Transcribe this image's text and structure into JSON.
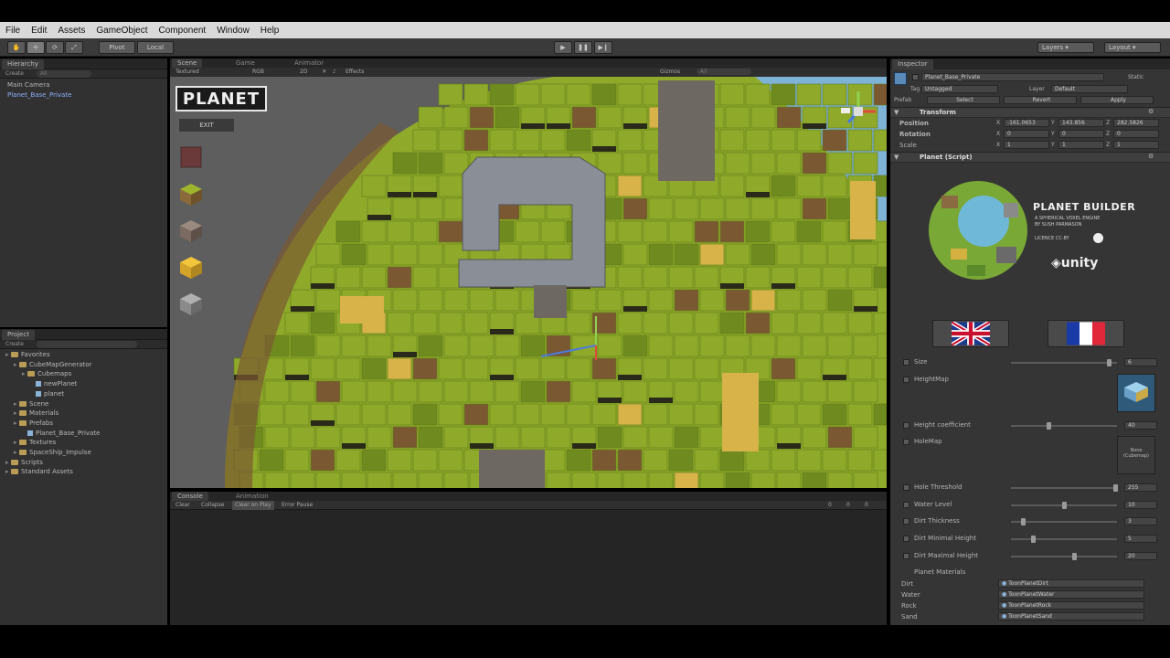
{
  "menu": [
    "File",
    "Edit",
    "Assets",
    "GameObject",
    "Component",
    "Window",
    "Help"
  ],
  "toolbar": {
    "pivot": "Pivot",
    "local": "Local",
    "layers": "Layers",
    "layout": "Layout"
  },
  "hierarchy": {
    "tab": "Hierarchy",
    "create": "Create",
    "search_placeholder": "All",
    "items": [
      "Main Camera",
      "Planet_Base_Private"
    ]
  },
  "project": {
    "tab": "Project",
    "create": "Create",
    "tree": [
      {
        "label": "Favorites",
        "indent": 0,
        "kind": "folder"
      },
      {
        "label": "CubeMapGenerator",
        "indent": 1,
        "kind": "folder"
      },
      {
        "label": "Cubemaps",
        "indent": 2,
        "kind": "folder"
      },
      {
        "label": "newPlanet",
        "indent": 3,
        "kind": "file"
      },
      {
        "label": "planet",
        "indent": 3,
        "kind": "file"
      },
      {
        "label": "Scene",
        "indent": 1,
        "kind": "folder"
      },
      {
        "label": "Materials",
        "indent": 1,
        "kind": "folder"
      },
      {
        "label": "Prefabs",
        "indent": 1,
        "kind": "folder"
      },
      {
        "label": "Planet_Base_Private",
        "indent": 2,
        "kind": "file"
      },
      {
        "label": "Textures",
        "indent": 1,
        "kind": "folder"
      },
      {
        "label": "SpaceShip_Impulse",
        "indent": 1,
        "kind": "folder"
      },
      {
        "label": "Scripts",
        "indent": 0,
        "kind": "folder"
      },
      {
        "label": "Standard Assets",
        "indent": 0,
        "kind": "folder"
      }
    ]
  },
  "scene": {
    "tabs": [
      "Scene",
      "Game",
      "Animator"
    ],
    "shading": "Textured",
    "rgb": "RGB",
    "mode_2d": "2D",
    "effects": "Effects",
    "gizmos": "Gizmos",
    "search_placeholder": "All",
    "logo": "PLANET",
    "exit": "EXIT"
  },
  "console": {
    "tabs": [
      "Console",
      "Animation"
    ],
    "buttons": [
      "Clear",
      "Collapse",
      "Clear on Play",
      "Error Pause"
    ],
    "counts": [
      "0",
      "0",
      "0"
    ]
  },
  "inspector": {
    "tab": "Inspector",
    "object_name": "Planet_Base_Private",
    "static": "Static",
    "tag_label": "Tag",
    "tag_value": "Untagged",
    "layer_label": "Layer",
    "layer_value": "Default",
    "prefab_label": "Prefab",
    "prefab_buttons": [
      "Select",
      "Revert",
      "Apply"
    ],
    "transform": {
      "title": "Transform",
      "rows": [
        {
          "label": "Position",
          "x": "-161.0653",
          "y": "143.856",
          "z": "282.5826"
        },
        {
          "label": "Rotation",
          "x": "0",
          "y": "0",
          "z": "0"
        },
        {
          "label": "Scale",
          "x": "1",
          "y": "1",
          "z": "1"
        }
      ]
    },
    "script_title": "Planet (Script)",
    "banner": {
      "title": "PLANET BUILDER",
      "sub1": "A SPHERICAL VOXEL ENGINE",
      "sub2": "BY SUSH PARMASON",
      "license": "LICENCE CC-BY",
      "engine": "unity"
    },
    "props": [
      {
        "label": "Size",
        "value": "6",
        "kind": "slider",
        "pos": 0.94
      },
      {
        "label": "HeightMap",
        "value": "",
        "kind": "texture"
      },
      {
        "label": "Height coefficient",
        "value": "40",
        "kind": "slider",
        "pos": 0.35
      },
      {
        "label": "HoleMap",
        "value": "None (Cubemap)",
        "kind": "texture2"
      },
      {
        "label": "Hole Threshold",
        "value": "255",
        "kind": "slider",
        "pos": 1.0
      },
      {
        "label": "Water Level",
        "value": "10",
        "kind": "slider",
        "pos": 0.5
      },
      {
        "label": "Dirt Thickness",
        "value": "3",
        "kind": "slider",
        "pos": 0.1
      },
      {
        "label": "Dirt Minimal Height",
        "value": "5",
        "kind": "slider",
        "pos": 0.2
      },
      {
        "label": "Dirt Maximal Height",
        "value": "20",
        "kind": "slider",
        "pos": 0.6
      }
    ],
    "planet_materials": "Planet Materials",
    "materials": [
      {
        "label": "Dirt",
        "value": "ToonPlanetDirt"
      },
      {
        "label": "Water",
        "value": "ToonPlanetWater"
      },
      {
        "label": "Rock",
        "value": "ToonPlanetRock"
      },
      {
        "label": "Sand",
        "value": "ToonPlanetSand"
      }
    ]
  },
  "colors": {
    "grass": "#8faa2a",
    "grass_dark": "#6f8a1e",
    "dirt": "#7a5832",
    "sand": "#d7b34a",
    "stone": "#8a8e96",
    "water": "#7fb3d6"
  }
}
